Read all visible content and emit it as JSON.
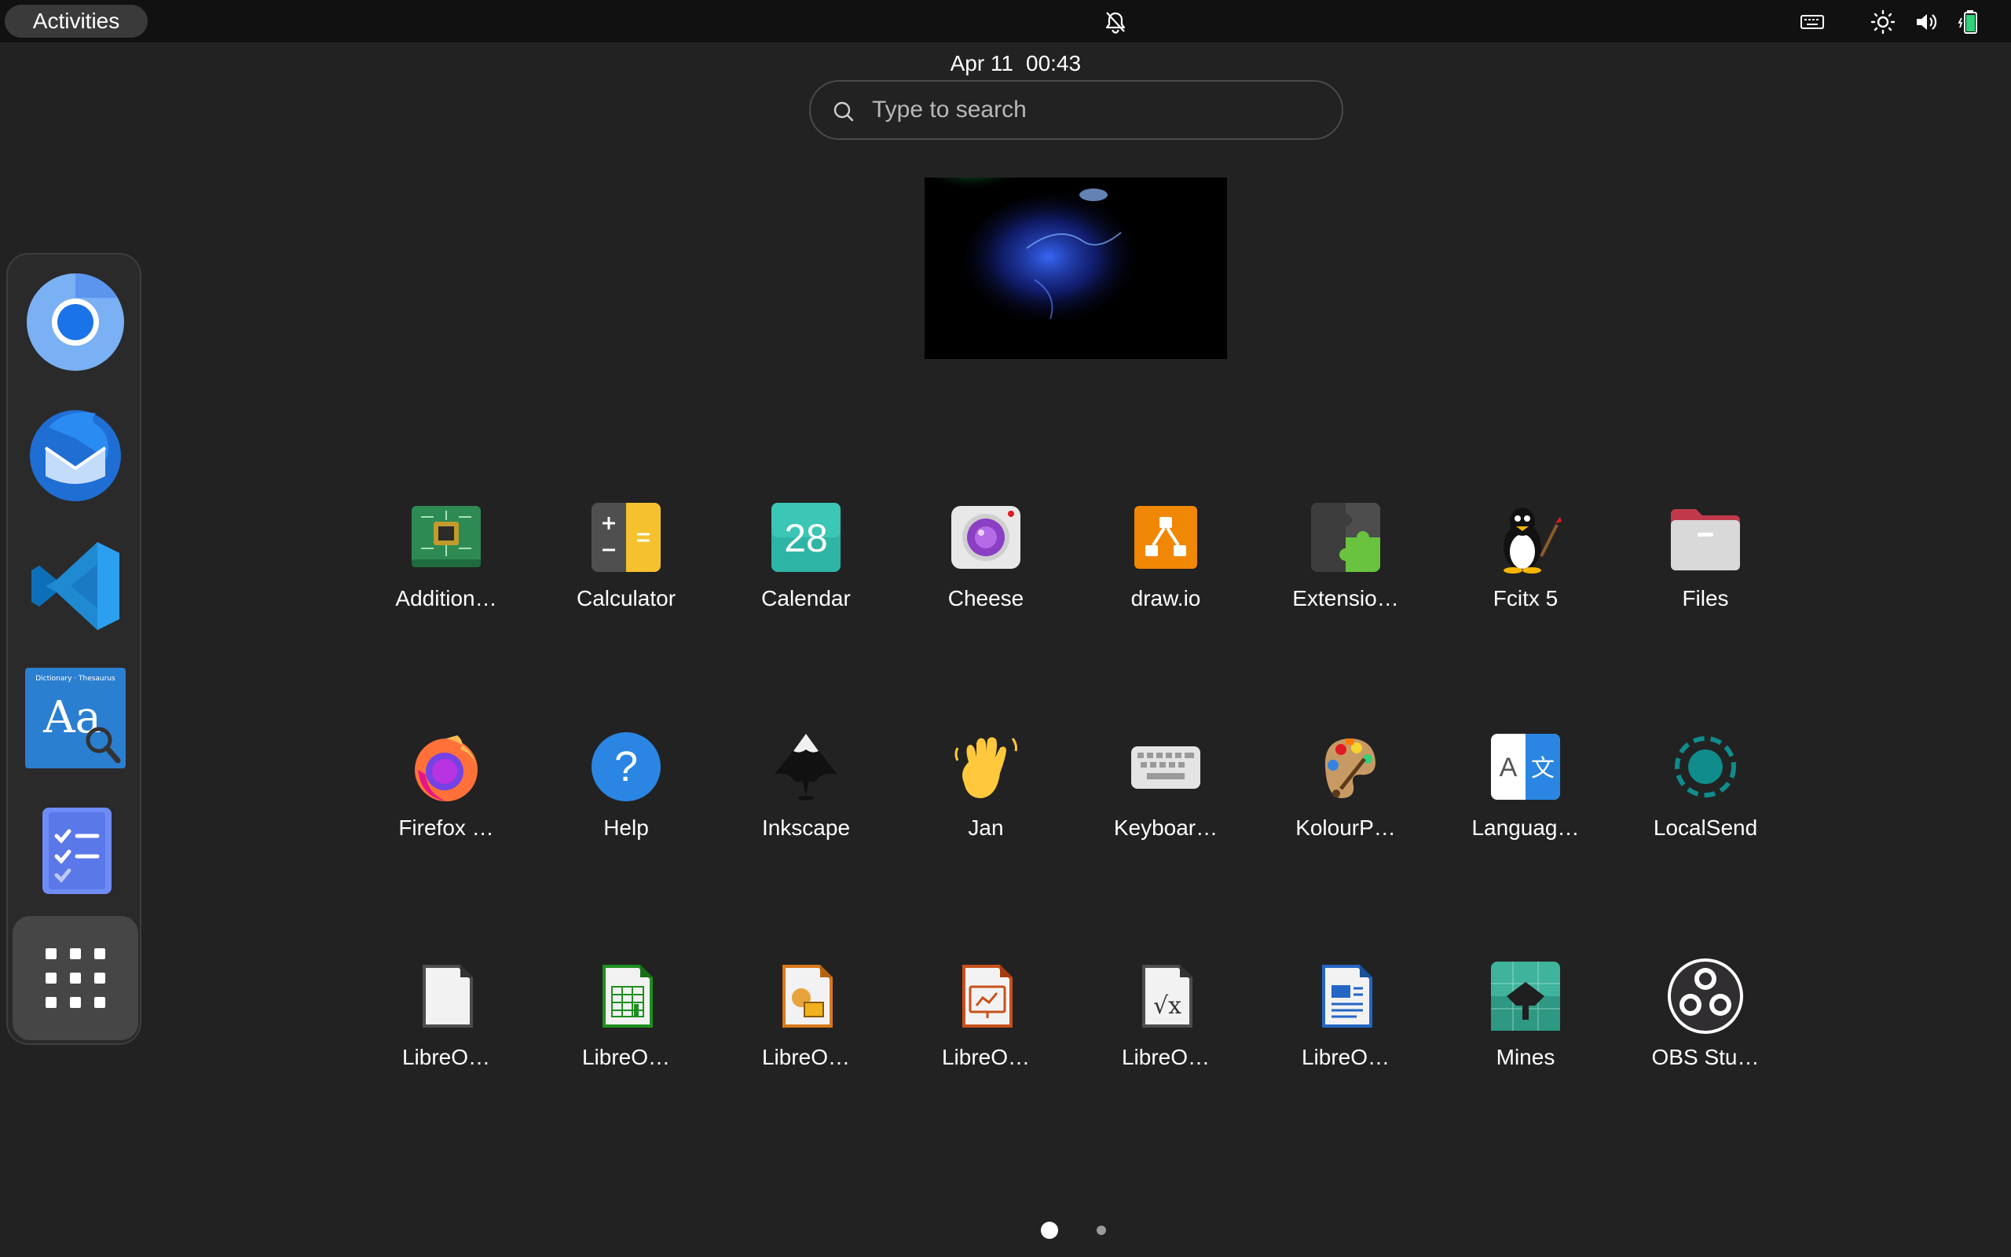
{
  "topbar": {
    "activities_label": "Activities",
    "date": "Apr 11",
    "time": "00:43",
    "icons": [
      "bell-off-icon",
      "keyboard-icon",
      "brightness-icon",
      "volume-icon",
      "battery-icon"
    ]
  },
  "search": {
    "placeholder": "Type to search",
    "value": ""
  },
  "dock": {
    "items": [
      {
        "name": "chromium-icon"
      },
      {
        "name": "thunderbird-icon"
      },
      {
        "name": "vscode-icon"
      },
      {
        "name": "dictionary-icon",
        "caption": "Dictionary · Thesaurus"
      },
      {
        "name": "tasks-icon"
      },
      {
        "name": "show-apps-icon"
      }
    ]
  },
  "app_grid": {
    "rows": [
      [
        {
          "label": "Addition…",
          "icon": "additional-drivers-icon"
        },
        {
          "label": "Calculator",
          "icon": "calculator-icon"
        },
        {
          "label": "Calendar",
          "icon": "calendar-icon",
          "icon_text": "28"
        },
        {
          "label": "Cheese",
          "icon": "cheese-icon"
        },
        {
          "label": "draw.io",
          "icon": "drawio-icon"
        },
        {
          "label": "Extensio…",
          "icon": "extensions-icon"
        },
        {
          "label": "Fcitx 5",
          "icon": "fcitx-icon"
        },
        {
          "label": "Files",
          "icon": "files-icon"
        }
      ],
      [
        {
          "label": "Firefox …",
          "icon": "firefox-icon"
        },
        {
          "label": "Help",
          "icon": "help-icon",
          "icon_text": "?"
        },
        {
          "label": "Inkscape",
          "icon": "inkscape-icon"
        },
        {
          "label": "Jan",
          "icon": "jan-icon"
        },
        {
          "label": "Keyboar…",
          "icon": "keyboard-app-icon"
        },
        {
          "label": "KolourP…",
          "icon": "kolourpaint-icon"
        },
        {
          "label": "Languag…",
          "icon": "language-icon",
          "icon_text_left": "A",
          "icon_text_right": "文"
        },
        {
          "label": "LocalSend",
          "icon": "localsend-icon"
        }
      ],
      [
        {
          "label": "LibreO…",
          "icon": "libreoffice-icon"
        },
        {
          "label": "LibreO…",
          "icon": "libreoffice-calc-icon"
        },
        {
          "label": "LibreO…",
          "icon": "libreoffice-draw-icon"
        },
        {
          "label": "LibreO…",
          "icon": "libreoffice-impress-icon"
        },
        {
          "label": "LibreO…",
          "icon": "libreoffice-math-icon",
          "icon_text": "√x"
        },
        {
          "label": "LibreO…",
          "icon": "libreoffice-writer-icon"
        },
        {
          "label": "Mines",
          "icon": "mines-icon"
        },
        {
          "label": "OBS Stu…",
          "icon": "obs-studio-icon"
        }
      ]
    ]
  },
  "pagination": {
    "pages": 2,
    "current": 1
  },
  "colors": {
    "background": "#222222",
    "topbar": "#111111",
    "dock": "#2a2a2a"
  }
}
